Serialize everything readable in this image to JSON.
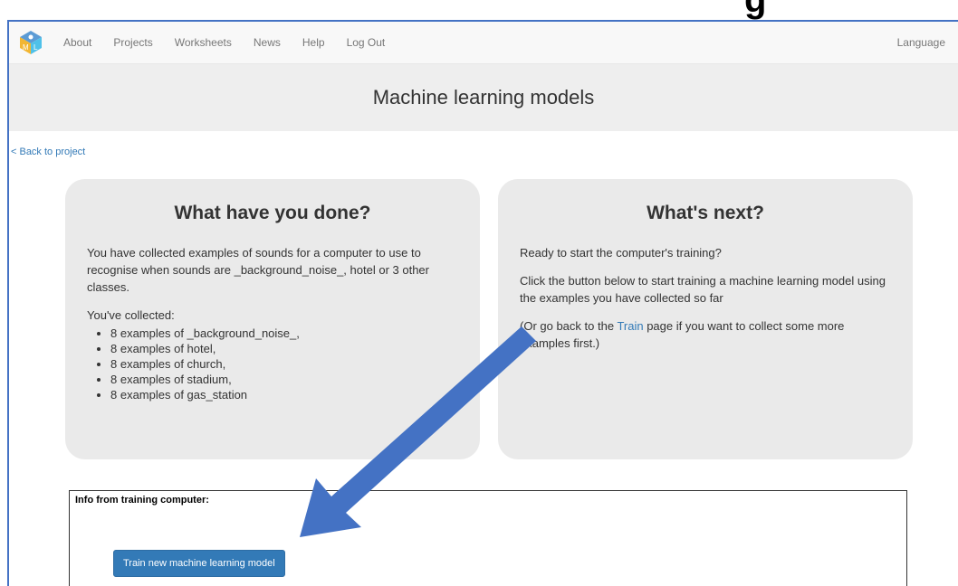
{
  "top_fragment": "g",
  "nav": {
    "items": [
      "About",
      "Projects",
      "Worksheets",
      "News",
      "Help",
      "Log Out"
    ],
    "language_label": "Language"
  },
  "header": {
    "title": "Machine learning models"
  },
  "back_link": "< Back to project",
  "done_panel": {
    "title": "What have you done?",
    "description": "You have collected examples of sounds for a computer to use to recognise when sounds are _background_noise_, hotel or 3 other classes.",
    "collected_label": "You've collected:",
    "items": [
      "8 examples of _background_noise_,",
      "8 examples of hotel,",
      "8 examples of church,",
      "8 examples of stadium,",
      "8 examples of gas_station"
    ]
  },
  "next_panel": {
    "title": "What's next?",
    "ready": "Ready to start the computer's training?",
    "instruction": "Click the button below to start training a machine learning model using the examples you have collected so far",
    "alt_prefix": "(Or go back to the ",
    "alt_link": "Train",
    "alt_suffix": " page if you want to collect some more examples first.)"
  },
  "info": {
    "label": "Info from training computer:",
    "button": "Train new machine learning model"
  },
  "colors": {
    "arrow": "#4472c4",
    "link": "#337ab7",
    "button": "#337ab7"
  }
}
